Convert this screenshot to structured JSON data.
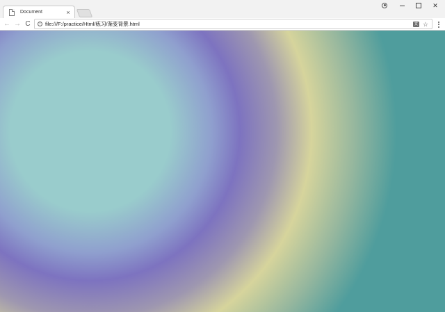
{
  "window": {
    "tab": {
      "title": "Document",
      "close_glyph": "×",
      "icon": "page-icon"
    },
    "controls": {
      "profile_icon": "account-icon",
      "minimize_icon": "minimize-icon",
      "maximize_icon": "maximize-icon",
      "close_glyph": "✕"
    }
  },
  "toolbar": {
    "back_glyph": "←",
    "forward_glyph": "→",
    "reload_glyph": "C",
    "address": {
      "security_glyph": "i",
      "url": "file:///F:/practice/Html/练习/渐变背景.html",
      "translate_glyph": "文",
      "bookmark_glyph": "☆"
    },
    "menu_icon": "more-vert-icon"
  },
  "page": {
    "gradient_colors": [
      "#99cccc",
      "#8f9fce",
      "#7d73c0",
      "#9e97b0",
      "#d6d49c",
      "#96b79e",
      "#4f9d9d"
    ]
  }
}
